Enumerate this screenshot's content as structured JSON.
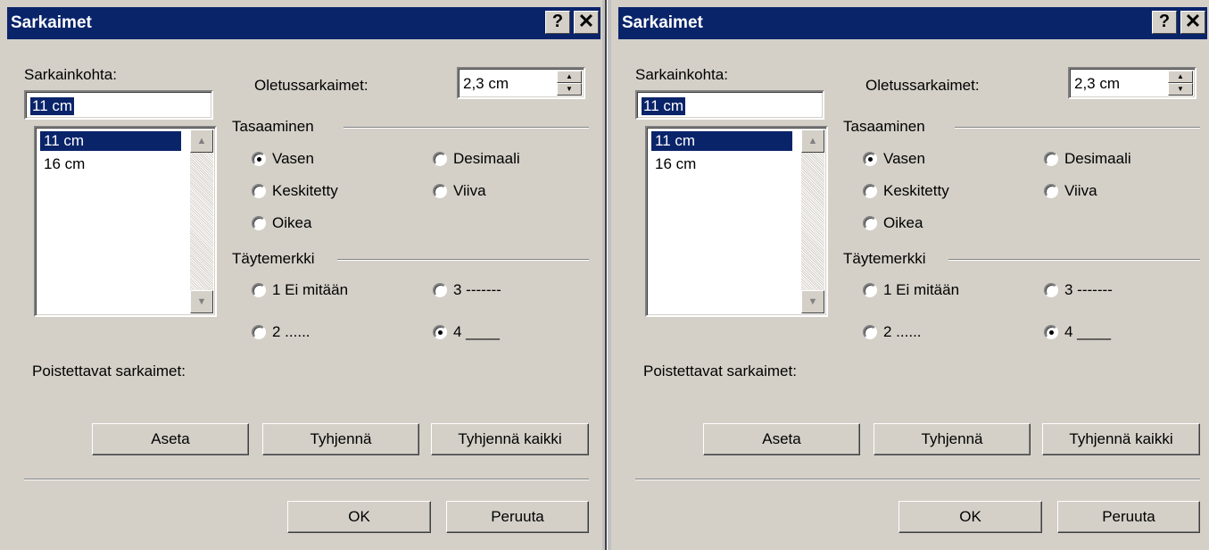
{
  "dialogs": [
    {
      "title": "Sarkaimet",
      "help_glyph": "?",
      "close_glyph": "✕",
      "tab_stop_label": "Sarkainkohta:",
      "tab_stop_value": "11 cm",
      "tab_list": [
        "11 cm",
        "16 cm"
      ],
      "default_tabs_label": "Oletussarkaimet:",
      "default_tabs_value": "2,3 cm",
      "alignment_group": "Tasaaminen",
      "alignment_options": [
        {
          "label": "Vasen",
          "checked": true
        },
        {
          "label": "Desimaali",
          "checked": false
        },
        {
          "label": "Keskitetty",
          "checked": false
        },
        {
          "label": "Viiva",
          "checked": false
        },
        {
          "label": "Oikea",
          "checked": false
        }
      ],
      "leader_group": "Täytemerkki",
      "leader_options": [
        {
          "label": "1 Ei mitään",
          "checked": false
        },
        {
          "label": "3 -------",
          "checked": false
        },
        {
          "label": "2 ......",
          "checked": false
        },
        {
          "label": "4 ____",
          "checked": true
        }
      ],
      "clear_label": "Poistettavat sarkaimet:",
      "buttons": {
        "set": "Aseta",
        "clear": "Tyhjennä",
        "clear_all": "Tyhjennä kaikki",
        "ok": "OK",
        "cancel": "Peruuta"
      }
    },
    {
      "title": "Sarkaimet",
      "help_glyph": "?",
      "close_glyph": "✕",
      "tab_stop_label": "Sarkainkohta:",
      "tab_stop_value": "11 cm",
      "tab_list": [
        "11 cm",
        "16 cm"
      ],
      "default_tabs_label": "Oletussarkaimet:",
      "default_tabs_value": "2,3 cm",
      "alignment_group": "Tasaaminen",
      "alignment_options": [
        {
          "label": "Vasen",
          "checked": true
        },
        {
          "label": "Desimaali",
          "checked": false
        },
        {
          "label": "Keskitetty",
          "checked": false
        },
        {
          "label": "Viiva",
          "checked": false
        },
        {
          "label": "Oikea",
          "checked": false
        }
      ],
      "leader_group": "Täytemerkki",
      "leader_options": [
        {
          "label": "1 Ei mitään",
          "checked": false
        },
        {
          "label": "3 -------",
          "checked": false
        },
        {
          "label": "2 ......",
          "checked": false
        },
        {
          "label": "4 ____",
          "checked": true
        }
      ],
      "clear_label": "Poistettavat sarkaimet:",
      "buttons": {
        "set": "Aseta",
        "clear": "Tyhjennä",
        "clear_all": "Tyhjennä kaikki",
        "ok": "OK",
        "cancel": "Peruuta"
      }
    }
  ]
}
